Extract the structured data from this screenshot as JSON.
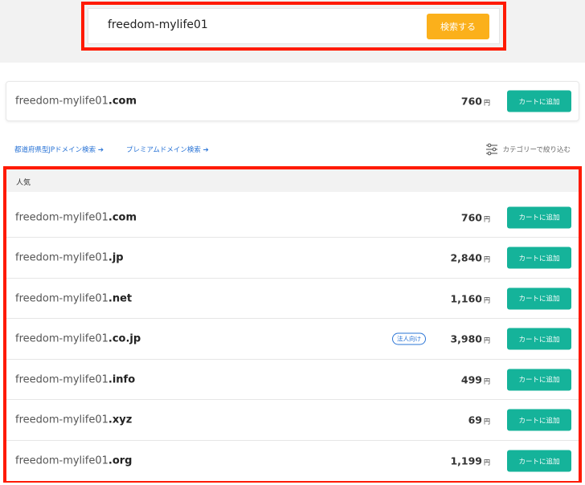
{
  "search": {
    "query": "freedom-mylife01",
    "button_label": "検索する"
  },
  "featured": {
    "name": "freedom-mylife01",
    "tld": ".com",
    "price": "760",
    "currency": "円",
    "button_label": "カートに追加"
  },
  "links": {
    "prefecture_jp": "都道府県型JPドメイン検索 ➔",
    "premium": "プレミアムドメイン検索 ➔"
  },
  "filter": {
    "label": "カテゴリーで絞り込む",
    "icon": "sliders-icon"
  },
  "popular": {
    "heading": "人気",
    "rows": [
      {
        "name": "freedom-mylife01",
        "tld": ".com",
        "price": "760",
        "currency": "円",
        "badge": "",
        "button_label": "カートに追加"
      },
      {
        "name": "freedom-mylife01",
        "tld": ".jp",
        "price": "2,840",
        "currency": "円",
        "badge": "",
        "button_label": "カートに追加"
      },
      {
        "name": "freedom-mylife01",
        "tld": ".net",
        "price": "1,160",
        "currency": "円",
        "badge": "",
        "button_label": "カートに追加"
      },
      {
        "name": "freedom-mylife01",
        "tld": ".co.jp",
        "price": "3,980",
        "currency": "円",
        "badge": "法人向け",
        "button_label": "カートに追加"
      },
      {
        "name": "freedom-mylife01",
        "tld": ".info",
        "price": "499",
        "currency": "円",
        "badge": "",
        "button_label": "カートに追加"
      },
      {
        "name": "freedom-mylife01",
        "tld": ".xyz",
        "price": "69",
        "currency": "円",
        "badge": "",
        "button_label": "カートに追加"
      },
      {
        "name": "freedom-mylife01",
        "tld": ".org",
        "price": "1,199",
        "currency": "円",
        "badge": "",
        "button_label": "カートに追加"
      }
    ]
  },
  "colors": {
    "highlight": "#ff1a00",
    "search_button": "#fbb01b",
    "cart_button": "#15b39a",
    "link": "#2a74d6"
  }
}
